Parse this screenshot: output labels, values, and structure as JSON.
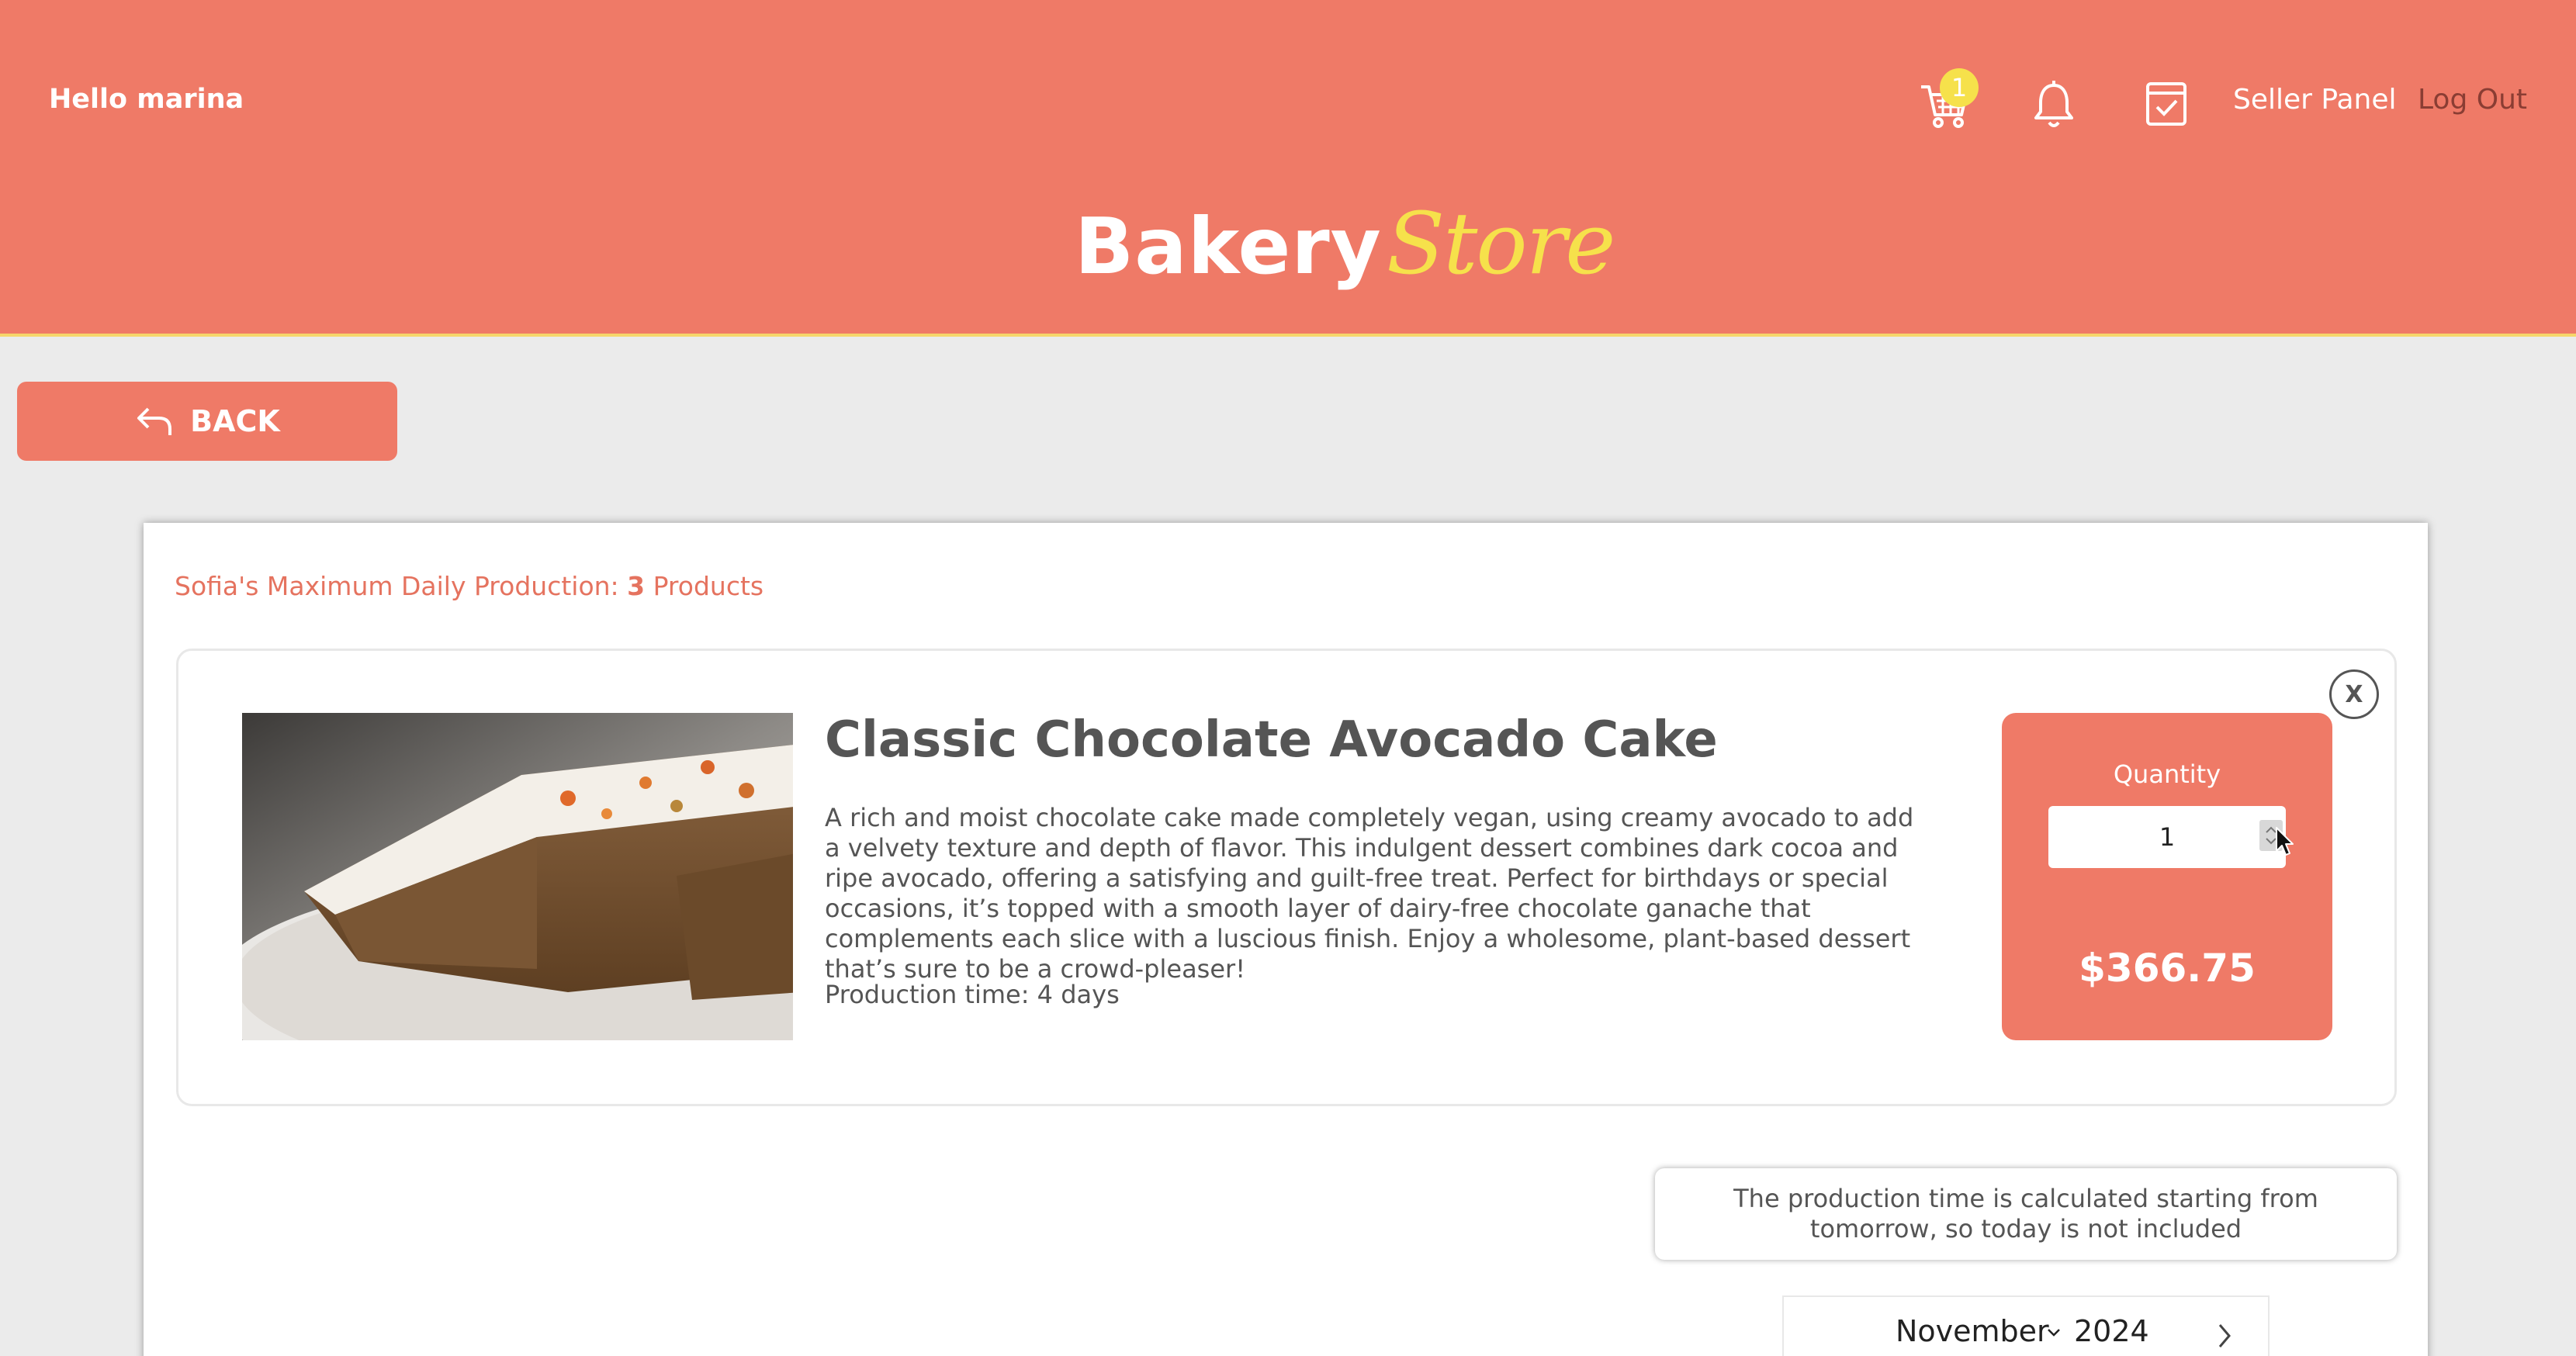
{
  "header": {
    "greeting": "Hello marina",
    "cart_count": "1",
    "seller_panel": "Seller Panel",
    "logout": "Log Out",
    "logo_part1": "Bakery",
    "logo_part2": "Store"
  },
  "back_button": {
    "label": "BACK"
  },
  "seller": {
    "max_prod_prefix": "Sofia's Maximum Daily Production: ",
    "max_prod_count": "3",
    "max_prod_suffix": " Products"
  },
  "product": {
    "title": "Classic Chocolate Avocado Cake",
    "description": "A rich and moist chocolate cake made completely vegan, using creamy avocado to add a velvety texture and depth of flavor. This indulgent dessert combines dark cocoa and ripe avocado, offering a satisfying and guilt-free treat. Perfect for birthdays or special occasions, it’s topped with a smooth layer of dairy-free chocolate ganache that complements each slice with a luscious finish. Enjoy a wholesome, plant-based dessert that’s sure to be a crowd-pleaser!",
    "production_time": "Production time: 4 days",
    "close_label": "X"
  },
  "order": {
    "quantity_label": "Quantity",
    "quantity_value": "1",
    "price": "$366.75"
  },
  "info": {
    "note": "The production time is calculated starting from tomorrow, so today is not included"
  },
  "calendar": {
    "month": "November",
    "year": "2024"
  },
  "colors": {
    "brand": "#ef7a67",
    "accent": "#f6e14b",
    "background": "#ebebeb"
  },
  "icons": [
    "cart-icon",
    "bell-icon",
    "calendar-check-icon",
    "back-arrow-icon",
    "close-icon",
    "chevron-down-icon",
    "chevron-right-icon",
    "cursor-icon"
  ]
}
